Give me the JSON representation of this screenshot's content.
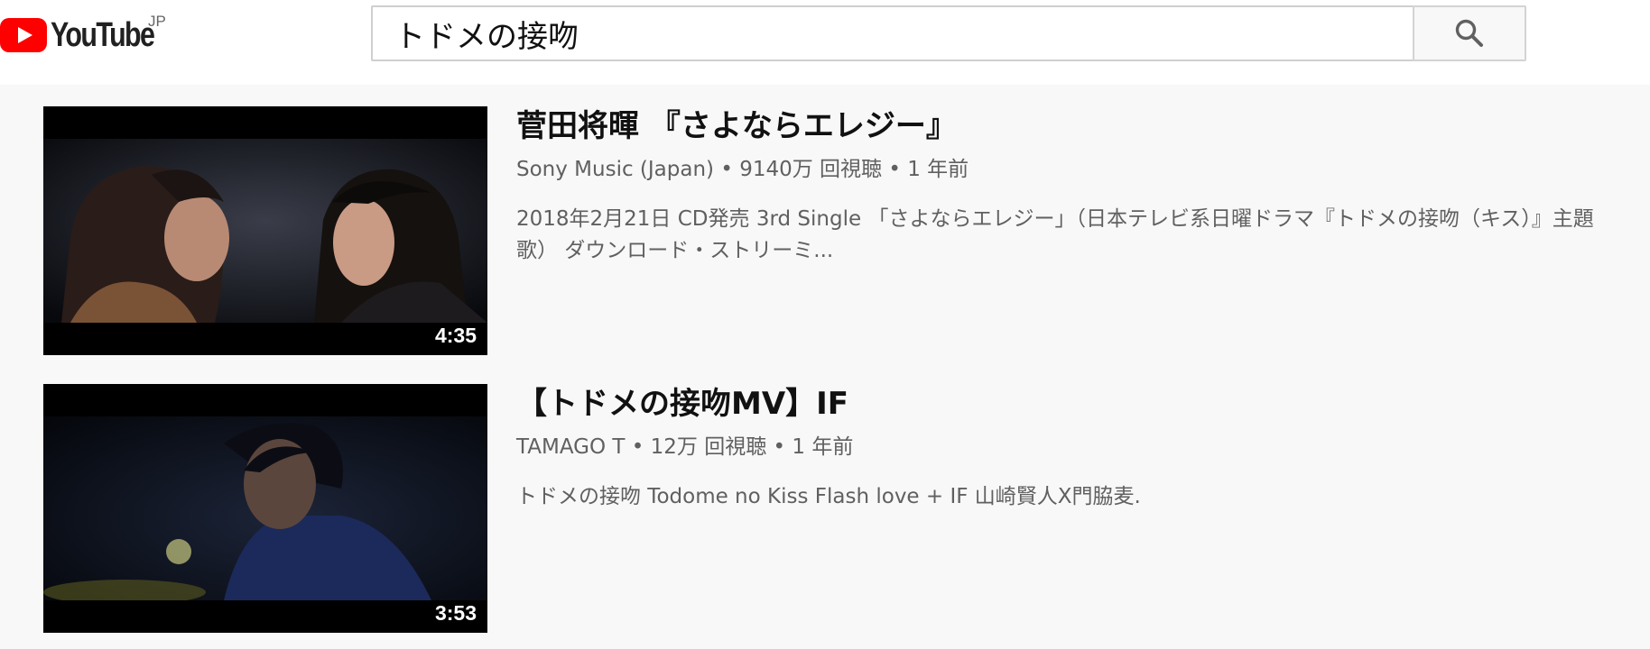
{
  "header": {
    "logo_text": "YouTube",
    "region": "JP",
    "search": {
      "value": "トドメの接吻",
      "placeholder": ""
    },
    "search_icon": "search-icon"
  },
  "results": [
    {
      "title": "菅田将暉 『さよならエレジー』",
      "channel": "Sony Music (Japan)",
      "views": "9140万 回視聴",
      "age": "1 年前",
      "byline": "Sony Music (Japan) • 9140万 回視聴 • 1 年前",
      "description": "2018年2月21日 CD発売 3rd Single 「さよならエレジー」（日本テレビ系日曜ドラマ『トドメの接吻（キス）』主題歌） ダウンロード・ストリーミ...",
      "duration": "4:35"
    },
    {
      "title": "【トドメの接吻MV】IF",
      "channel": "TAMAGO T",
      "views": "12万 回視聴",
      "age": "1 年前",
      "byline": "TAMAGO T • 12万 回視聴 • 1 年前",
      "description": "トドメの接吻 Todome no Kiss Flash love + IF 山崎賢人X門脇麦.",
      "duration": "3:53"
    }
  ],
  "colors": {
    "brand_red": "#ff0000",
    "background": "#f8f8f8",
    "title_text": "#111111",
    "secondary_text": "#606060"
  }
}
